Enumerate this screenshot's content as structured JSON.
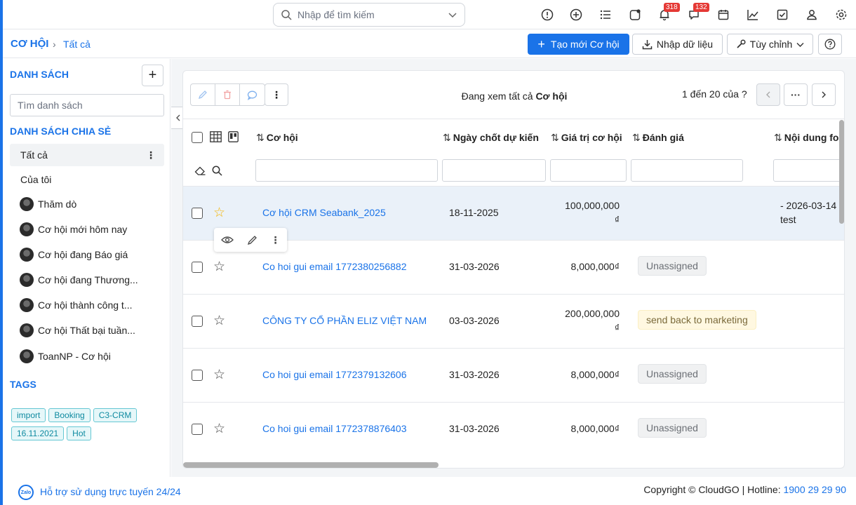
{
  "topbar": {
    "search_placeholder": "Nhập để tìm kiếm",
    "notif_badge": "318",
    "chat_badge": "132"
  },
  "breadcrumb": {
    "module": "CƠ HỘI",
    "current": "Tất cả"
  },
  "toolbar": {
    "create_label": "Tạo mới Cơ hội",
    "import_label": "Nhập dữ liệu",
    "customize_label": "Tùy chỉnh"
  },
  "sidebar": {
    "lists_title": "DANH SÁCH",
    "search_placeholder": "Tìm danh sách",
    "shared_title": "DANH SÁCH CHIA SẺ",
    "items": [
      {
        "label": "Tất cả"
      },
      {
        "label": "Của tôi"
      },
      {
        "label": "Thăm dò"
      },
      {
        "label": "Cơ hội mới hôm nay"
      },
      {
        "label": "Cơ hội đang Báo giá"
      },
      {
        "label": "Cơ hội đang Thương..."
      },
      {
        "label": "Cơ hội thành công t..."
      },
      {
        "label": "Cơ hội Thất bại tuần..."
      },
      {
        "label": "ToanNP - Cơ hội"
      }
    ],
    "tags_title": "TAGS",
    "tags": [
      "import",
      "Booking",
      "C3-CRM",
      "16.11.2021",
      "Hot"
    ]
  },
  "main": {
    "viewing_prefix": "Đang xem tất cả",
    "viewing_module": "Cơ hội",
    "pager": "1 đến 20 của ?",
    "columns": [
      "Cơ hội",
      "Ngày chốt dự kiến",
      "Giá trị cơ hội",
      "Đánh giá",
      "Nội dung fol"
    ],
    "rows": [
      {
        "name": "Cơ hội CRM Seabank_2025",
        "date": "18-11-2025",
        "value1": "100,000,000",
        "value2": "₫",
        "rating": "",
        "content1": "- 2026-03-14",
        "content2": "test",
        "starred": true
      },
      {
        "name": "Co hoi gui email 1772380256882",
        "date": "31-03-2026",
        "value1": "8,000,000₫",
        "value2": "",
        "rating": "Unassigned",
        "content1": "",
        "content2": "",
        "starred": false
      },
      {
        "name": "CÔNG TY CỔ PHẦN ELIZ VIỆT NAM",
        "date": "03-03-2026",
        "value1": "200,000,000",
        "value2": "₫",
        "rating": "send back to marketing",
        "content1": "",
        "content2": "",
        "starred": false
      },
      {
        "name": "Co hoi gui email 1772379132606",
        "date": "31-03-2026",
        "value1": "8,000,000₫",
        "value2": "",
        "rating": "Unassigned",
        "content1": "",
        "content2": "",
        "starred": false
      },
      {
        "name": "Co hoi gui email 1772378876403",
        "date": "31-03-2026",
        "value1": "8,000,000₫",
        "value2": "",
        "rating": "Unassigned",
        "content1": "",
        "content2": "",
        "starred": false
      }
    ]
  },
  "footer": {
    "zalo": "Zalo",
    "support": "Hỗ trợ sử dụng trực tuyến 24/24",
    "copyright": "Copyright © CloudGO",
    "hotline_label": "Hotline:",
    "hotline": "1900 29 29 90"
  },
  "colors": {
    "accent": "#1a73e8",
    "star": "#f5b400",
    "badge": "#e53935"
  }
}
